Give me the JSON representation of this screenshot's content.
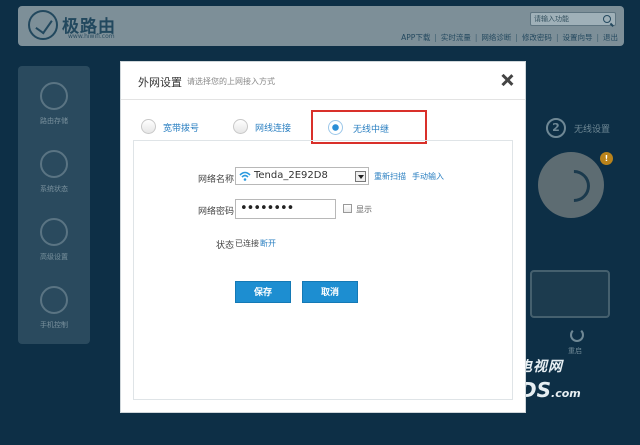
{
  "header": {
    "brand": "极路由",
    "brand_url": "www.hiwifi.com",
    "search_placeholder": "请输入功能",
    "nav": [
      "APP下载",
      "实时流量",
      "网络诊断",
      "修改密码",
      "设置向导",
      "退出"
    ]
  },
  "sidebar": {
    "items": [
      {
        "label": "路由存储",
        "icon": "storage-icon"
      },
      {
        "label": "系统状态",
        "icon": "pulse-icon"
      },
      {
        "label": "高级设置",
        "icon": "gear-icon"
      },
      {
        "label": "手机控制",
        "icon": "phone-icon"
      }
    ]
  },
  "right_panel": {
    "step_number": "2",
    "step_label": "无线设置",
    "warn_badge": "!",
    "power_label": "重启"
  },
  "watermark": {
    "line1": "电视网",
    "line2": "DS",
    "line2_suffix": ".com"
  },
  "dialog": {
    "title": "外网设置",
    "subtitle": "请选择您的上网接入方式",
    "tabs": [
      {
        "label": "宽带拨号",
        "selected": false
      },
      {
        "label": "网线连接",
        "selected": false
      },
      {
        "label": "无线中继",
        "selected": true
      }
    ],
    "form": {
      "network_name_label": "网络名称",
      "network_name_value": "Tenda_2E92D8",
      "rescan_link": "重新扫描",
      "manual_input_link": "手动输入",
      "password_label": "网络密码",
      "password_value": "••••••••",
      "show_label": "显示",
      "status_label": "状态",
      "status_value": "已连接",
      "disconnect_link": "断开"
    },
    "buttons": {
      "save": "保存",
      "cancel": "取消"
    }
  },
  "colors": {
    "accent": "#1d8ed1",
    "link": "#2a7fc1",
    "highlight_border": "#d9302a",
    "overlay_bg": "#0d2f46"
  }
}
